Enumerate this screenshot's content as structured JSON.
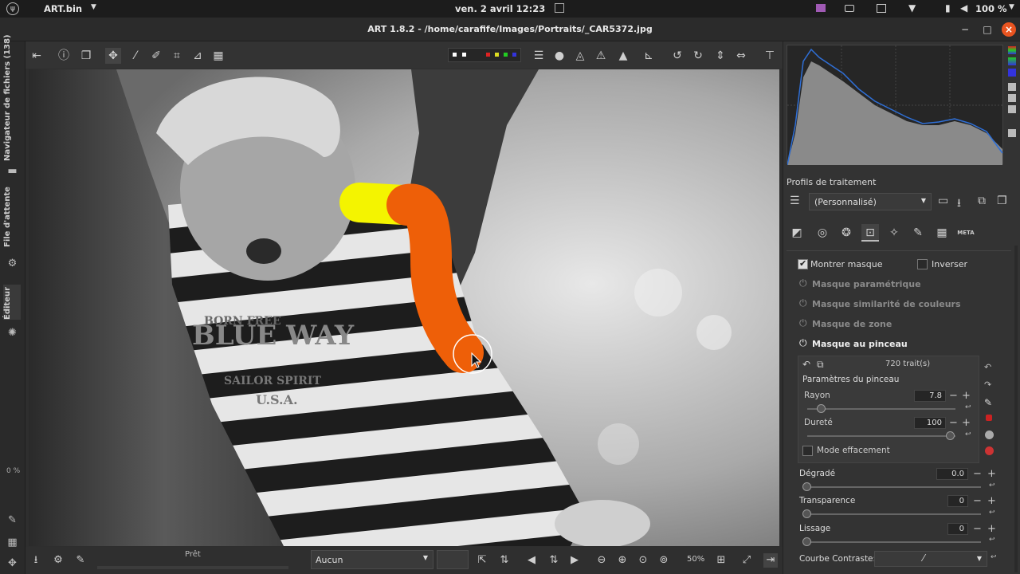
{
  "system_bar": {
    "app_menu": "ART.bin",
    "datetime": "ven. 2 avril  12:23",
    "battery": "100 %"
  },
  "window": {
    "title": "ART 1.8.2 - /home/carafife/Images/Portraits/_CAR5372.jpg"
  },
  "left_tabs": {
    "file_browser": "Navigateur de fichiers (138)",
    "queue": "File d'attente",
    "editor": "Éditeur",
    "percent": "0 %"
  },
  "bottom_bar": {
    "status": "Prêt",
    "preview_mode": "Aucun",
    "zoom": "50%"
  },
  "right_panel": {
    "profiles_title": "Profils de traitement",
    "profile_value": "(Personnalisé)",
    "show_mask": "Montrer masque",
    "invert": "Inverser",
    "param_mask": "Masque paramétrique",
    "color_mask": "Masque similarité de couleurs",
    "area_mask": "Masque de zone",
    "brush_mask": "Masque au pinceau",
    "strokes": "720 trait(s)",
    "brush_params_title": "Paramètres du pinceau",
    "radius_label": "Rayon",
    "radius_value": "7.8",
    "hardness_label": "Dureté",
    "hardness_value": "100",
    "erase_mode": "Mode effacement",
    "gradient_label": "Dégradé",
    "gradient_value": "0.0",
    "transparency_label": "Transparence",
    "transparency_value": "0",
    "smoothing_label": "Lissage",
    "smoothing_value": "0",
    "contrast_curve_label": "Courbe Contraste:",
    "meta_tab": "META"
  },
  "image_text": {
    "shirt_line1": "BORN FREE",
    "shirt_line2": "BLUE WAY",
    "shirt_line3": "SAILOR SPIRIT",
    "shirt_line4": "U.S.A."
  },
  "colors": {
    "accent_orange": "#e95420",
    "mask_yellow": "#f4f400",
    "mask_orange": "#ee5f08",
    "histogram_blue": "#2f6fd6"
  }
}
